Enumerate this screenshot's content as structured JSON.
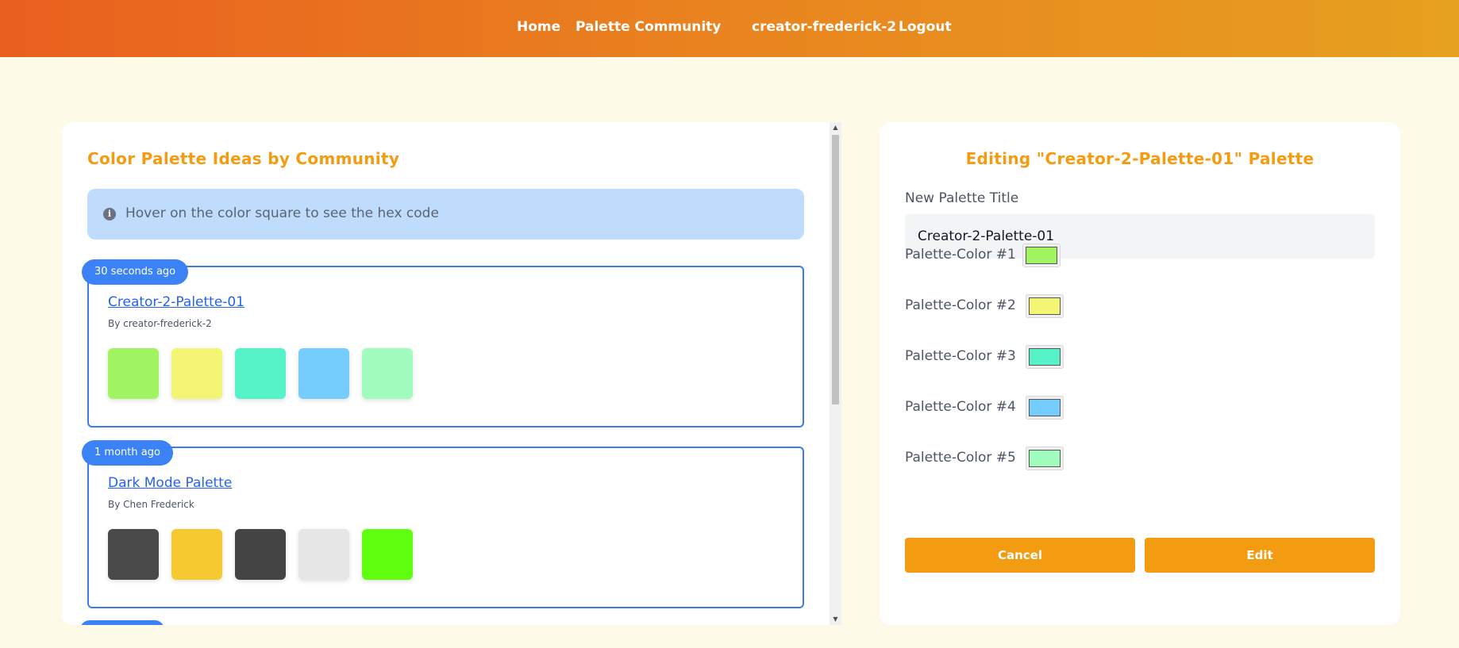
{
  "nav": {
    "home": "Home",
    "community": "Palette Community",
    "user": "creator-frederick-2",
    "logout": "Logout"
  },
  "community_panel": {
    "title": "Color Palette Ideas by Community",
    "info_icon": "info-icon",
    "info_text": "Hover on the color square to see the hex code",
    "palettes": [
      {
        "time": "30 seconds ago",
        "title": "Creator-2-Palette-01",
        "author": "By creator-frederick-2",
        "colors": [
          "#a0f462",
          "#f4f475",
          "#56f2c8",
          "#74cdfd",
          "#a0fdbd"
        ]
      },
      {
        "time": "1 month ago",
        "title": "Dark Mode Palette",
        "author": "By Chen Frederick",
        "colors": [
          "#4a4a4a",
          "#f6c930",
          "#444444",
          "#e6e6e6",
          "#60ff10"
        ]
      }
    ]
  },
  "edit_panel": {
    "title": "Editing \"Creator-2-Palette-01\" Palette",
    "title_label": "New Palette Title",
    "title_value": "Creator-2-Palette-01",
    "colors": [
      {
        "label": "Palette-Color #1",
        "value": "#a0f462"
      },
      {
        "label": "Palette-Color #2",
        "value": "#f4f475"
      },
      {
        "label": "Palette-Color #3",
        "value": "#56f2c8"
      },
      {
        "label": "Palette-Color #4",
        "value": "#74cdfd"
      },
      {
        "label": "Palette-Color #5",
        "value": "#a0fdbd"
      }
    ],
    "cancel_label": "Cancel",
    "edit_label": "Edit"
  },
  "theme": {
    "accent": "#f39c12",
    "link": "#2563eb",
    "badge": "#3b82f6",
    "info_bg": "#bfdcfd",
    "page_bg": "#fefae8"
  }
}
